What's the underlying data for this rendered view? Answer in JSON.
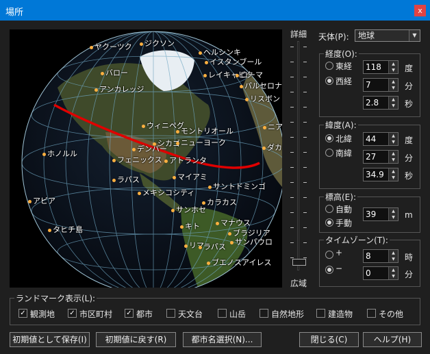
{
  "window": {
    "title": "場所",
    "close_label": "x"
  },
  "globe": {
    "cities": [
      {
        "name": "ヤクーツク",
        "dot": "right"
      },
      {
        "name": "ジクソン",
        "dot": "left"
      },
      {
        "name": "ヘルシンキ",
        "dot": "left"
      },
      {
        "name": "イスタンブール",
        "dot": "left"
      },
      {
        "name": "バロー",
        "dot": "right"
      },
      {
        "name": "レイキャビク",
        "dot": "left"
      },
      {
        "name": "ローマ",
        "dot": "left"
      },
      {
        "name": "パルセロナ",
        "dot": "left"
      },
      {
        "name": "アンカレッジ",
        "dot": "right"
      },
      {
        "name": "リスボン",
        "dot": "left"
      },
      {
        "name": "ウィニペグ",
        "dot": "left"
      },
      {
        "name": "モントリオール",
        "dot": "left"
      },
      {
        "name": "ニア",
        "dot": "left"
      },
      {
        "name": "シカゴ",
        "dot": "left"
      },
      {
        "name": "ニューヨーク",
        "dot": "left"
      },
      {
        "name": "ダカー",
        "dot": "left"
      },
      {
        "name": "デンバー",
        "dot": "left"
      },
      {
        "name": "ホノルル",
        "dot": "left"
      },
      {
        "name": "フェニックス",
        "dot": "left"
      },
      {
        "name": "アトランタ",
        "dot": "left"
      },
      {
        "name": "マイアミ",
        "dot": "left"
      },
      {
        "name": "ラパス",
        "dot": "left"
      },
      {
        "name": "サントドミンゴ",
        "dot": "left"
      },
      {
        "name": "メキシコシティ",
        "dot": "left"
      },
      {
        "name": "アピア",
        "dot": "left"
      },
      {
        "name": "カラカス",
        "dot": "left"
      },
      {
        "name": "サンホセ",
        "dot": "left"
      },
      {
        "name": "タヒチ島",
        "dot": "left"
      },
      {
        "name": "マナウス",
        "dot": "left"
      },
      {
        "name": "キト",
        "dot": "left"
      },
      {
        "name": "ブラジリア",
        "dot": "left"
      },
      {
        "name": "サンパウロ",
        "dot": "left"
      },
      {
        "name": "リマ",
        "dot": "left"
      },
      {
        "name": "ラパス",
        "dot": "left"
      },
      {
        "name": "ブエノスアイレス",
        "dot": "left"
      }
    ]
  },
  "zoom": {
    "top_label": "詳細",
    "bottom_label": "広域",
    "level": 0.95
  },
  "celestial": {
    "label": "天体(P):",
    "selected": "地球"
  },
  "longitude": {
    "legend": "経度(O):",
    "east_label": "東経",
    "west_label": "西経",
    "selected": "west",
    "degrees": "118",
    "minutes": "7",
    "seconds": "2.8",
    "deg_unit": "度",
    "min_unit": "分",
    "sec_unit": "秒"
  },
  "latitude": {
    "legend": "緯度(A):",
    "north_label": "北緯",
    "south_label": "南緯",
    "selected": "north",
    "degrees": "44",
    "minutes": "27",
    "seconds": "34.9",
    "deg_unit": "度",
    "min_unit": "分",
    "sec_unit": "秒"
  },
  "elevation": {
    "legend": "標高(E):",
    "auto_label": "自動",
    "manual_label": "手動",
    "selected": "manual",
    "value": "39",
    "unit": "m"
  },
  "timezone": {
    "legend": "タイムゾーン(T):",
    "plus_label": "+",
    "minus_label": "−",
    "selected": "minus",
    "hours": "8",
    "minutes": "0",
    "hour_unit": "時",
    "min_unit": "分"
  },
  "landmarks": {
    "legend": "ランドマーク表示(L):",
    "items": [
      {
        "label": "観測地",
        "checked": true
      },
      {
        "label": "市区町村",
        "checked": true
      },
      {
        "label": "都市",
        "checked": true
      },
      {
        "label": "天文台",
        "checked": false
      },
      {
        "label": "山岳",
        "checked": false
      },
      {
        "label": "自然地形",
        "checked": false
      },
      {
        "label": "建造物",
        "checked": false
      },
      {
        "label": "その他",
        "checked": false
      }
    ]
  },
  "buttons": {
    "save_default": "初期値として保存(I)",
    "restore_default": "初期値に戻す(R)",
    "select_city": "都市名選択(N)...",
    "close": "閉じる(C)",
    "help": "ヘルプ(H)"
  },
  "colors": {
    "titlebar": "#0078d7",
    "track_line": "#e00000",
    "city_dot": "#ffb040"
  }
}
